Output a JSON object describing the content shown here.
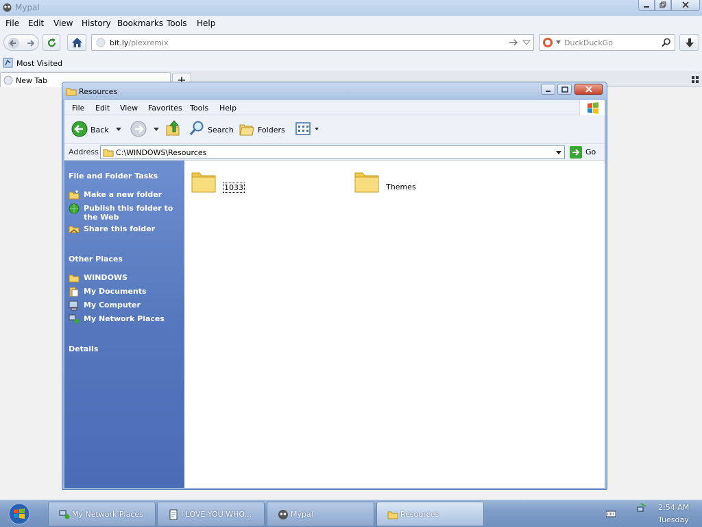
{
  "browser": {
    "title": "Mypal",
    "menu": [
      "File",
      "Edit",
      "View",
      "History",
      "Bookmarks",
      "Tools",
      "Help"
    ],
    "url_host": "bit.ly",
    "url_path": "/plexremix",
    "search_placeholder": "DuckDuckGo",
    "bookmark": "Most Visited",
    "tab_label": "New Tab",
    "new_tab_symbol": "+"
  },
  "explorer": {
    "title": "Resources",
    "menu": [
      "File",
      "Edit",
      "View",
      "Favorites",
      "Tools",
      "Help"
    ],
    "toolbar": {
      "back": "Back",
      "search": "Search",
      "folders": "Folders"
    },
    "address_label": "Address",
    "address_value": "C:\\WINDOWS\\Resources",
    "go_label": "Go",
    "tasks": {
      "heading": "File and Folder Tasks",
      "items": [
        {
          "label": "Make a new folder",
          "icon": "new-folder-icon"
        },
        {
          "label": "Publish this folder to the Web",
          "icon": "globe-icon"
        },
        {
          "label": "Share this folder",
          "icon": "share-folder-icon"
        }
      ]
    },
    "places": {
      "heading": "Other Places",
      "items": [
        {
          "label": "WINDOWS",
          "icon": "folder-icon"
        },
        {
          "label": "My Documents",
          "icon": "documents-icon"
        },
        {
          "label": "My Computer",
          "icon": "computer-icon"
        },
        {
          "label": "My Network Places",
          "icon": "network-icon"
        }
      ]
    },
    "details_heading": "Details",
    "folders": [
      {
        "name": "1033",
        "selected": true
      },
      {
        "name": "Themes",
        "selected": false
      }
    ]
  },
  "taskbar": {
    "buttons": [
      {
        "label": "My Network Places",
        "icon": "network-icon",
        "active": false
      },
      {
        "label": "I LOVE YOU WHO...",
        "icon": "notepad-icon",
        "active": false
      },
      {
        "label": "Mypal",
        "icon": "mypal-icon",
        "active": false
      },
      {
        "label": "Resources",
        "icon": "folder-icon",
        "active": true
      }
    ],
    "time": "2:54 AM",
    "day": "Tuesday"
  }
}
